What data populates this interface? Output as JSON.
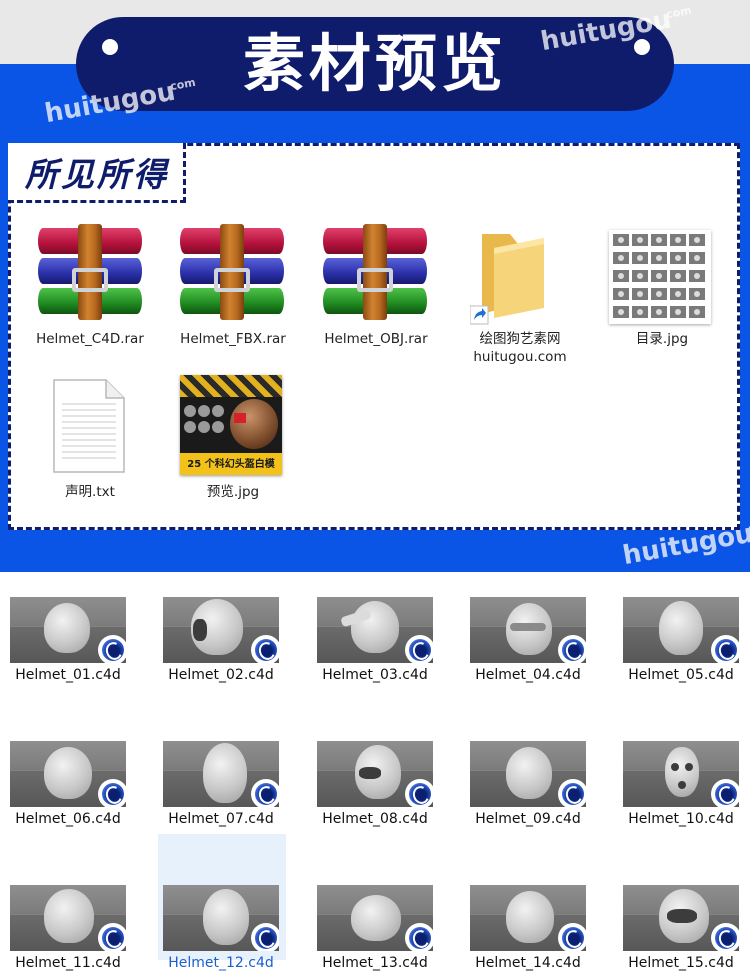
{
  "header": {
    "title": "素材预览",
    "watermark_text": "huitugou",
    "watermark_suffix": ".com"
  },
  "panel": {
    "badge": "所见所得",
    "files": [
      {
        "name": "Helmet_C4D.rar",
        "icon": "winrar-archive-icon"
      },
      {
        "name": "Helmet_FBX.rar",
        "icon": "winrar-archive-icon"
      },
      {
        "name": "Helmet_OBJ.rar",
        "icon": "winrar-archive-icon"
      },
      {
        "name": "绘图狗艺素网\nhuitugou.com",
        "line1": "绘图狗艺素网",
        "line2": "huitugou.com",
        "icon": "folder-shortcut-icon"
      },
      {
        "name": "目录.jpg",
        "icon": "image-thumbnail-icon"
      },
      {
        "name": "声明.txt",
        "icon": "text-document-icon"
      },
      {
        "name": "预览.jpg",
        "icon": "image-thumbnail-icon"
      }
    ],
    "preview_caption": "25 个科幻头盔白模"
  },
  "grid": {
    "items": [
      {
        "name": "Helmet_01.c4d"
      },
      {
        "name": "Helmet_02.c4d"
      },
      {
        "name": "Helmet_03.c4d"
      },
      {
        "name": "Helmet_04.c4d"
      },
      {
        "name": "Helmet_05.c4d"
      },
      {
        "name": "Helmet_06.c4d"
      },
      {
        "name": "Helmet_07.c4d"
      },
      {
        "name": "Helmet_08.c4d"
      },
      {
        "name": "Helmet_09.c4d"
      },
      {
        "name": "Helmet_10.c4d"
      },
      {
        "name": "Helmet_11.c4d"
      },
      {
        "name": "Helmet_12.c4d",
        "selected": true
      },
      {
        "name": "Helmet_13.c4d"
      },
      {
        "name": "Helmet_14.c4d"
      },
      {
        "name": "Helmet_15.c4d"
      }
    ],
    "file_icon": "cinema4d-icon"
  },
  "colors": {
    "blue_band": "#0a55e6",
    "navy": "#0f1b6b",
    "selection": "#e6f1fb"
  }
}
